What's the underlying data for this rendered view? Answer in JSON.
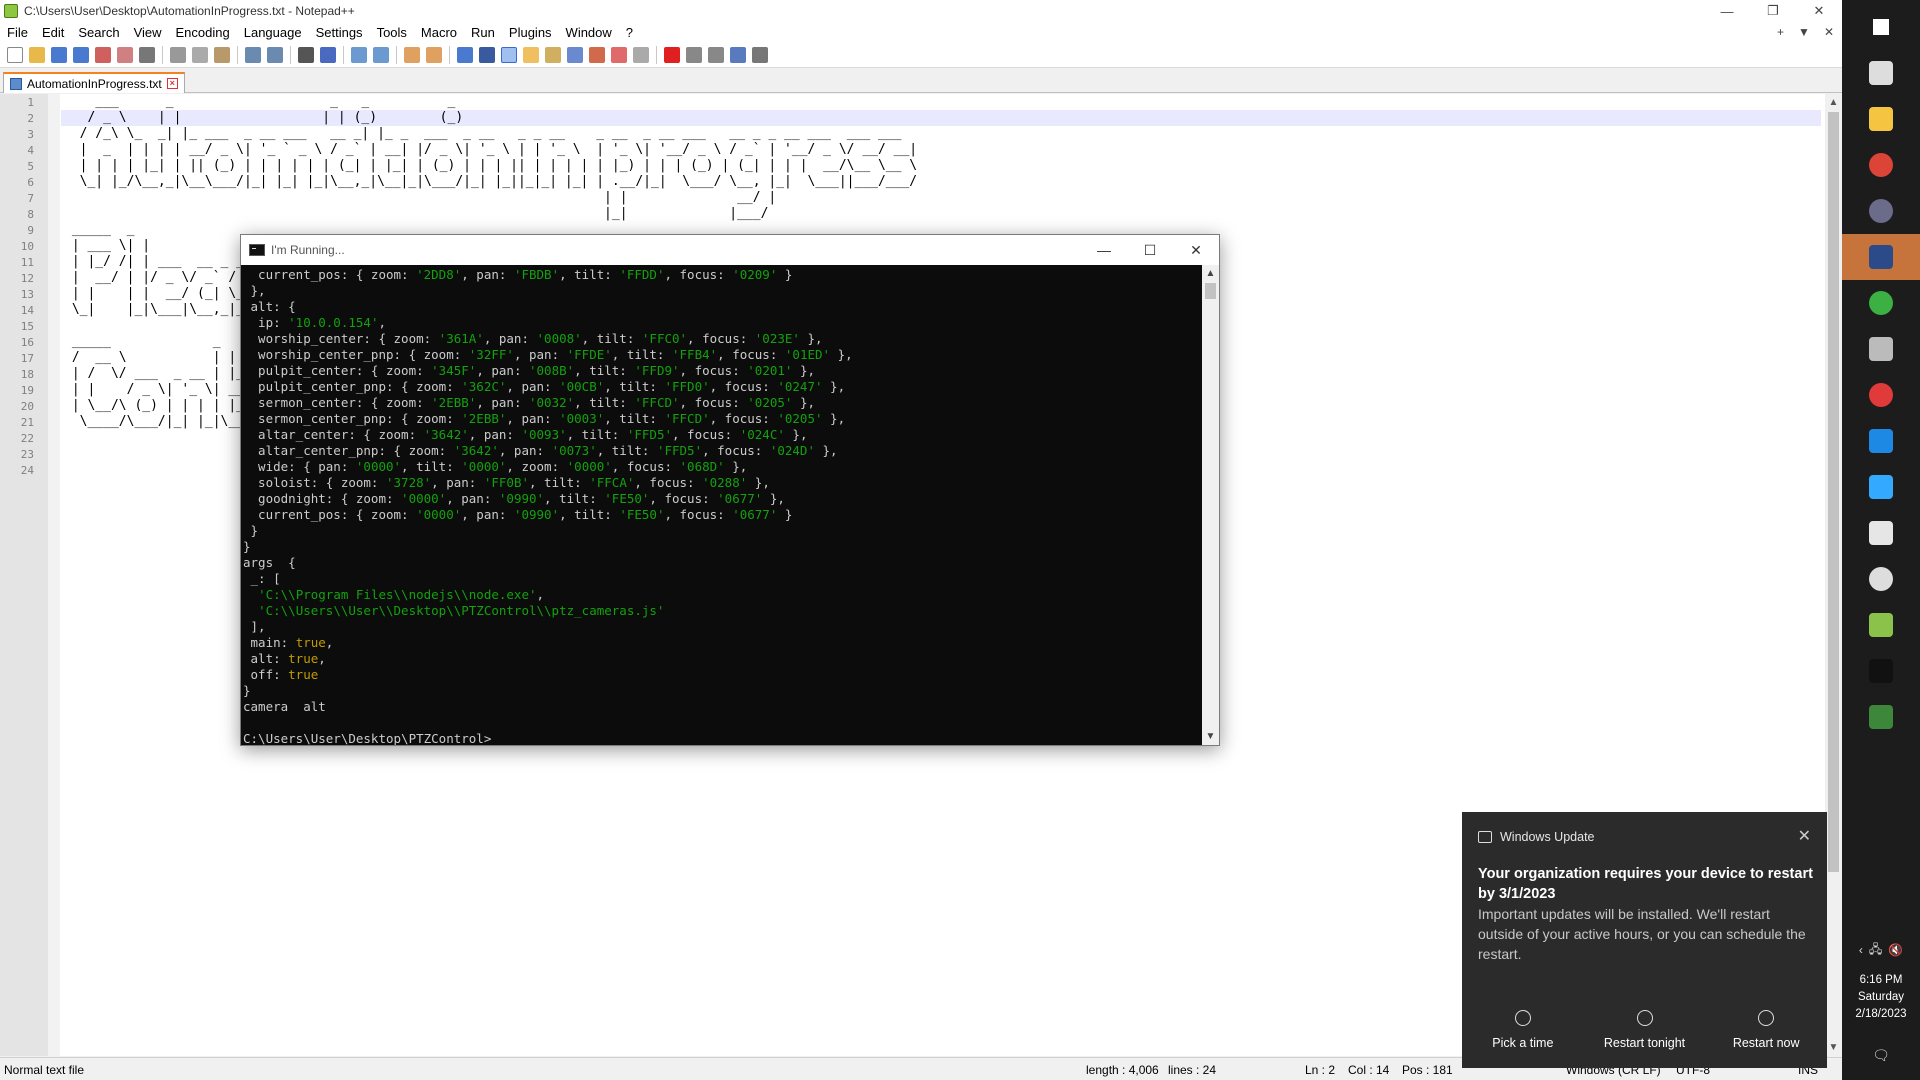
{
  "window": {
    "title": "C:\\Users\\User\\Desktop\\AutomationInProgress.txt - Notepad++",
    "minimize": "—",
    "maximize": "❐",
    "close": "✕"
  },
  "menu": [
    "File",
    "Edit",
    "Search",
    "View",
    "Encoding",
    "Language",
    "Settings",
    "Tools",
    "Macro",
    "Run",
    "Plugins",
    "Window",
    "?"
  ],
  "doc_controls": [
    "+",
    "▼",
    "✕"
  ],
  "tab": {
    "label": "AutomationInProgress.txt",
    "close": "×"
  },
  "editor": {
    "line_numbers": [
      "1",
      "2",
      "3",
      "4",
      "5",
      "6",
      "7",
      "8",
      "9",
      "10",
      "11",
      "12",
      "13",
      "14",
      "15",
      "16",
      "17",
      "18",
      "19",
      "20",
      "21",
      "22",
      "23",
      "24"
    ],
    "lines": [
      "    ___      _                    _   _          _",
      "   / _ \\    | |                  | | (_)        (_)",
      "  / /_\\ \\_  _| |_ ___  _ __ ___   __ _| |_ _  ___  _ __   _ _ __    _ __  _ __ ___   __ _ _ __ ___  ___ ___",
      "  |  _  | | | | __/ _ \\| '_ ` _ \\ / _` | __| |/ _ \\| '_ \\ | | '_ \\  | '_ \\| '__/ _ \\ / _` | '__/ _ \\/ __/ __|",
      "  | | | | |_| | || (_) | | | | | | (_| | |_| | (_) | | | || | | | | | |_) | | | (_) | (_| | | |  __/\\__ \\__ \\",
      "  \\_| |_/\\__,_|\\__\\___/|_| |_| |_|\\__,_|\\__|_|\\___/|_| |_||_|_| |_| | .__/|_|  \\___/ \\__, |_|  \\___||___/___/",
      "                                                                     | |              __/ |",
      "                                                                     |_|             |___/",
      " _____  _",
      " | ___ \\| |",
      " | |_/ /| | ___  __ _ ___  ___",
      " |  __/ | |/ _ \\/ _` / __|/ _ \\",
      " | |    | |  __/ (_| \\__ \\  __/",
      " \\_|    |_|\\___|\\__,_|___/\\___|",
      "",
      " _____             _   _",
      " /  __ \\           | | (_)",
      " | /  \\/ ___  _ __ | |_ _ _ __  _   _  ___",
      " | |    / _ \\| '_ \\| __| | '_ \\| | | |/ _ \\",
      " | \\__/\\ (_) | | | | |_| | | | | |_| |  __/",
      "  \\____/\\___/|_| |_|\\__|_|_| |_|\\__,_|\\___|",
      "",
      "",
      ""
    ]
  },
  "status": {
    "file_type": "Normal text file",
    "length": "length : 4,006",
    "lines": "lines : 24",
    "ln": "Ln : 2",
    "col": "Col : 14",
    "pos": "Pos : 181",
    "eol": "Windows (CR LF)",
    "encoding": "UTF-8",
    "mode": "INS"
  },
  "console": {
    "title": "I'm Running...",
    "minimize": "—",
    "maximize": "☐",
    "close": "✕",
    "lines": [
      [
        [
          "  current_pos: { zoom: ",
          ""
        ],
        [
          "'2DD8'",
          "s"
        ],
        [
          ", pan: ",
          ""
        ],
        [
          "'FBDB'",
          "s"
        ],
        [
          ", tilt: ",
          ""
        ],
        [
          "'FFDD'",
          "s"
        ],
        [
          ", focus: ",
          ""
        ],
        [
          "'0209'",
          "s"
        ],
        [
          " }",
          ""
        ]
      ],
      [
        [
          " },",
          ""
        ]
      ],
      [
        [
          " alt: {",
          ""
        ]
      ],
      [
        [
          "  ip: ",
          ""
        ],
        [
          "'10.0.0.154'",
          "s"
        ],
        [
          ",",
          ""
        ]
      ],
      [
        [
          "  worship_center: { zoom: ",
          ""
        ],
        [
          "'361A'",
          "s"
        ],
        [
          ", pan: ",
          ""
        ],
        [
          "'0008'",
          "s"
        ],
        [
          ", tilt: ",
          ""
        ],
        [
          "'FFC0'",
          "s"
        ],
        [
          ", focus: ",
          ""
        ],
        [
          "'023E'",
          "s"
        ],
        [
          " },",
          ""
        ]
      ],
      [
        [
          "  worship_center_pnp: { zoom: ",
          ""
        ],
        [
          "'32FF'",
          "s"
        ],
        [
          ", pan: ",
          ""
        ],
        [
          "'FFDE'",
          "s"
        ],
        [
          ", tilt: ",
          ""
        ],
        [
          "'FFB4'",
          "s"
        ],
        [
          ", focus: ",
          ""
        ],
        [
          "'01ED'",
          "s"
        ],
        [
          " },",
          ""
        ]
      ],
      [
        [
          "  pulpit_center: { zoom: ",
          ""
        ],
        [
          "'345F'",
          "s"
        ],
        [
          ", pan: ",
          ""
        ],
        [
          "'008B'",
          "s"
        ],
        [
          ", tilt: ",
          ""
        ],
        [
          "'FFD9'",
          "s"
        ],
        [
          ", focus: ",
          ""
        ],
        [
          "'0201'",
          "s"
        ],
        [
          " },",
          ""
        ]
      ],
      [
        [
          "  pulpit_center_pnp: { zoom: ",
          ""
        ],
        [
          "'362C'",
          "s"
        ],
        [
          ", pan: ",
          ""
        ],
        [
          "'00CB'",
          "s"
        ],
        [
          ", tilt: ",
          ""
        ],
        [
          "'FFD0'",
          "s"
        ],
        [
          ", focus: ",
          ""
        ],
        [
          "'0247'",
          "s"
        ],
        [
          " },",
          ""
        ]
      ],
      [
        [
          "  sermon_center: { zoom: ",
          ""
        ],
        [
          "'2EBB'",
          "s"
        ],
        [
          ", pan: ",
          ""
        ],
        [
          "'0032'",
          "s"
        ],
        [
          ", tilt: ",
          ""
        ],
        [
          "'FFCD'",
          "s"
        ],
        [
          ", focus: ",
          ""
        ],
        [
          "'0205'",
          "s"
        ],
        [
          " },",
          ""
        ]
      ],
      [
        [
          "  sermon_center_pnp: { zoom: ",
          ""
        ],
        [
          "'2EBB'",
          "s"
        ],
        [
          ", pan: ",
          ""
        ],
        [
          "'0003'",
          "s"
        ],
        [
          ", tilt: ",
          ""
        ],
        [
          "'FFCD'",
          "s"
        ],
        [
          ", focus: ",
          ""
        ],
        [
          "'0205'",
          "s"
        ],
        [
          " },",
          ""
        ]
      ],
      [
        [
          "  altar_center: { zoom: ",
          ""
        ],
        [
          "'3642'",
          "s"
        ],
        [
          ", pan: ",
          ""
        ],
        [
          "'0093'",
          "s"
        ],
        [
          ", tilt: ",
          ""
        ],
        [
          "'FFD5'",
          "s"
        ],
        [
          ", focus: ",
          ""
        ],
        [
          "'024C'",
          "s"
        ],
        [
          " },",
          ""
        ]
      ],
      [
        [
          "  altar_center_pnp: { zoom: ",
          ""
        ],
        [
          "'3642'",
          "s"
        ],
        [
          ", pan: ",
          ""
        ],
        [
          "'0073'",
          "s"
        ],
        [
          ", tilt: ",
          ""
        ],
        [
          "'FFD5'",
          "s"
        ],
        [
          ", focus: ",
          ""
        ],
        [
          "'024D'",
          "s"
        ],
        [
          " },",
          ""
        ]
      ],
      [
        [
          "  wide: { pan: ",
          ""
        ],
        [
          "'0000'",
          "s"
        ],
        [
          ", tilt: ",
          ""
        ],
        [
          "'0000'",
          "s"
        ],
        [
          ", zoom: ",
          ""
        ],
        [
          "'0000'",
          "s"
        ],
        [
          ", focus: ",
          ""
        ],
        [
          "'068D'",
          "s"
        ],
        [
          " },",
          ""
        ]
      ],
      [
        [
          "  soloist: { zoom: ",
          ""
        ],
        [
          "'3728'",
          "s"
        ],
        [
          ", pan: ",
          ""
        ],
        [
          "'FF0B'",
          "s"
        ],
        [
          ", tilt: ",
          ""
        ],
        [
          "'FFCA'",
          "s"
        ],
        [
          ", focus: ",
          ""
        ],
        [
          "'0288'",
          "s"
        ],
        [
          " },",
          ""
        ]
      ],
      [
        [
          "  goodnight: { zoom: ",
          ""
        ],
        [
          "'0000'",
          "s"
        ],
        [
          ", pan: ",
          ""
        ],
        [
          "'0990'",
          "s"
        ],
        [
          ", tilt: ",
          ""
        ],
        [
          "'FE50'",
          "s"
        ],
        [
          ", focus: ",
          ""
        ],
        [
          "'0677'",
          "s"
        ],
        [
          " },",
          ""
        ]
      ],
      [
        [
          "  current_pos: { zoom: ",
          ""
        ],
        [
          "'0000'",
          "s"
        ],
        [
          ", pan: ",
          ""
        ],
        [
          "'0990'",
          "s"
        ],
        [
          ", tilt: ",
          ""
        ],
        [
          "'FE50'",
          "s"
        ],
        [
          ", focus: ",
          ""
        ],
        [
          "'0677'",
          "s"
        ],
        [
          " }",
          ""
        ]
      ],
      [
        [
          " }",
          ""
        ]
      ],
      [
        [
          "}",
          ""
        ]
      ],
      [
        [
          "args  {",
          ""
        ]
      ],
      [
        [
          " _: [",
          ""
        ]
      ],
      [
        [
          "  ",
          ""
        ],
        [
          "'C:\\\\Program Files\\\\nodejs\\\\node.exe'",
          "s"
        ],
        [
          ",",
          ""
        ]
      ],
      [
        [
          "  ",
          ""
        ],
        [
          "'C:\\\\Users\\\\User\\\\Desktop\\\\PTZControl\\\\ptz_cameras.js'",
          "s"
        ]
      ],
      [
        [
          " ],",
          ""
        ]
      ],
      [
        [
          " main: ",
          ""
        ],
        [
          "true",
          "b"
        ],
        [
          ",",
          ""
        ]
      ],
      [
        [
          " alt: ",
          ""
        ],
        [
          "true",
          "b"
        ],
        [
          ",",
          ""
        ]
      ],
      [
        [
          " off: ",
          ""
        ],
        [
          "true",
          "b"
        ]
      ],
      [
        [
          "}",
          ""
        ]
      ],
      [
        [
          "camera  alt",
          ""
        ]
      ],
      [
        [
          "",
          ""
        ]
      ],
      [
        [
          "C:\\Users\\User\\Desktop\\PTZControl>",
          ""
        ]
      ]
    ]
  },
  "toast": {
    "app": "Windows Update",
    "close": "✕",
    "title": "Your organization requires your device to restart by 3/1/2023",
    "body": "Important updates will be installed. We'll restart outside of your active hours, or you can schedule the restart.",
    "actions": [
      "Pick a time",
      "Restart tonight",
      "Restart now"
    ]
  },
  "taskbar": {
    "icons": [
      {
        "name": "windows-start-icon",
        "color": "#ffffff"
      },
      {
        "name": "task-view-icon",
        "color": "#dddddd"
      },
      {
        "name": "file-explorer-icon",
        "color": "#f5c542"
      },
      {
        "name": "chrome-icon",
        "color": "#db4437"
      },
      {
        "name": "obs-icon",
        "color": "#6b6b8a"
      },
      {
        "name": "notepad-plus-plus-icon",
        "color": "#2a4a8a"
      },
      {
        "name": "upload-app-icon",
        "color": "#3cb043"
      },
      {
        "name": "network-app-icon",
        "color": "#bbbbbb"
      },
      {
        "name": "red-app-icon",
        "color": "#e03a3a"
      },
      {
        "name": "vscode-icon",
        "color": "#1e88e5"
      },
      {
        "name": "azure-app-icon",
        "color": "#33aaff"
      },
      {
        "name": "spreadsheet-app-icon",
        "color": "#e6e6e6"
      },
      {
        "name": "clock-app-icon",
        "color": "#dddddd"
      },
      {
        "name": "chart-app-icon",
        "color": "#8bc34a"
      },
      {
        "name": "terminal-icon",
        "color": "#111111"
      },
      {
        "name": "node-icon",
        "color": "#3c873a"
      }
    ],
    "tray": [
      "‹",
      "🖧",
      "🔇"
    ],
    "time": "6:16 PM",
    "day": "Saturday",
    "date": "2/18/2023",
    "notification": "🗨"
  }
}
